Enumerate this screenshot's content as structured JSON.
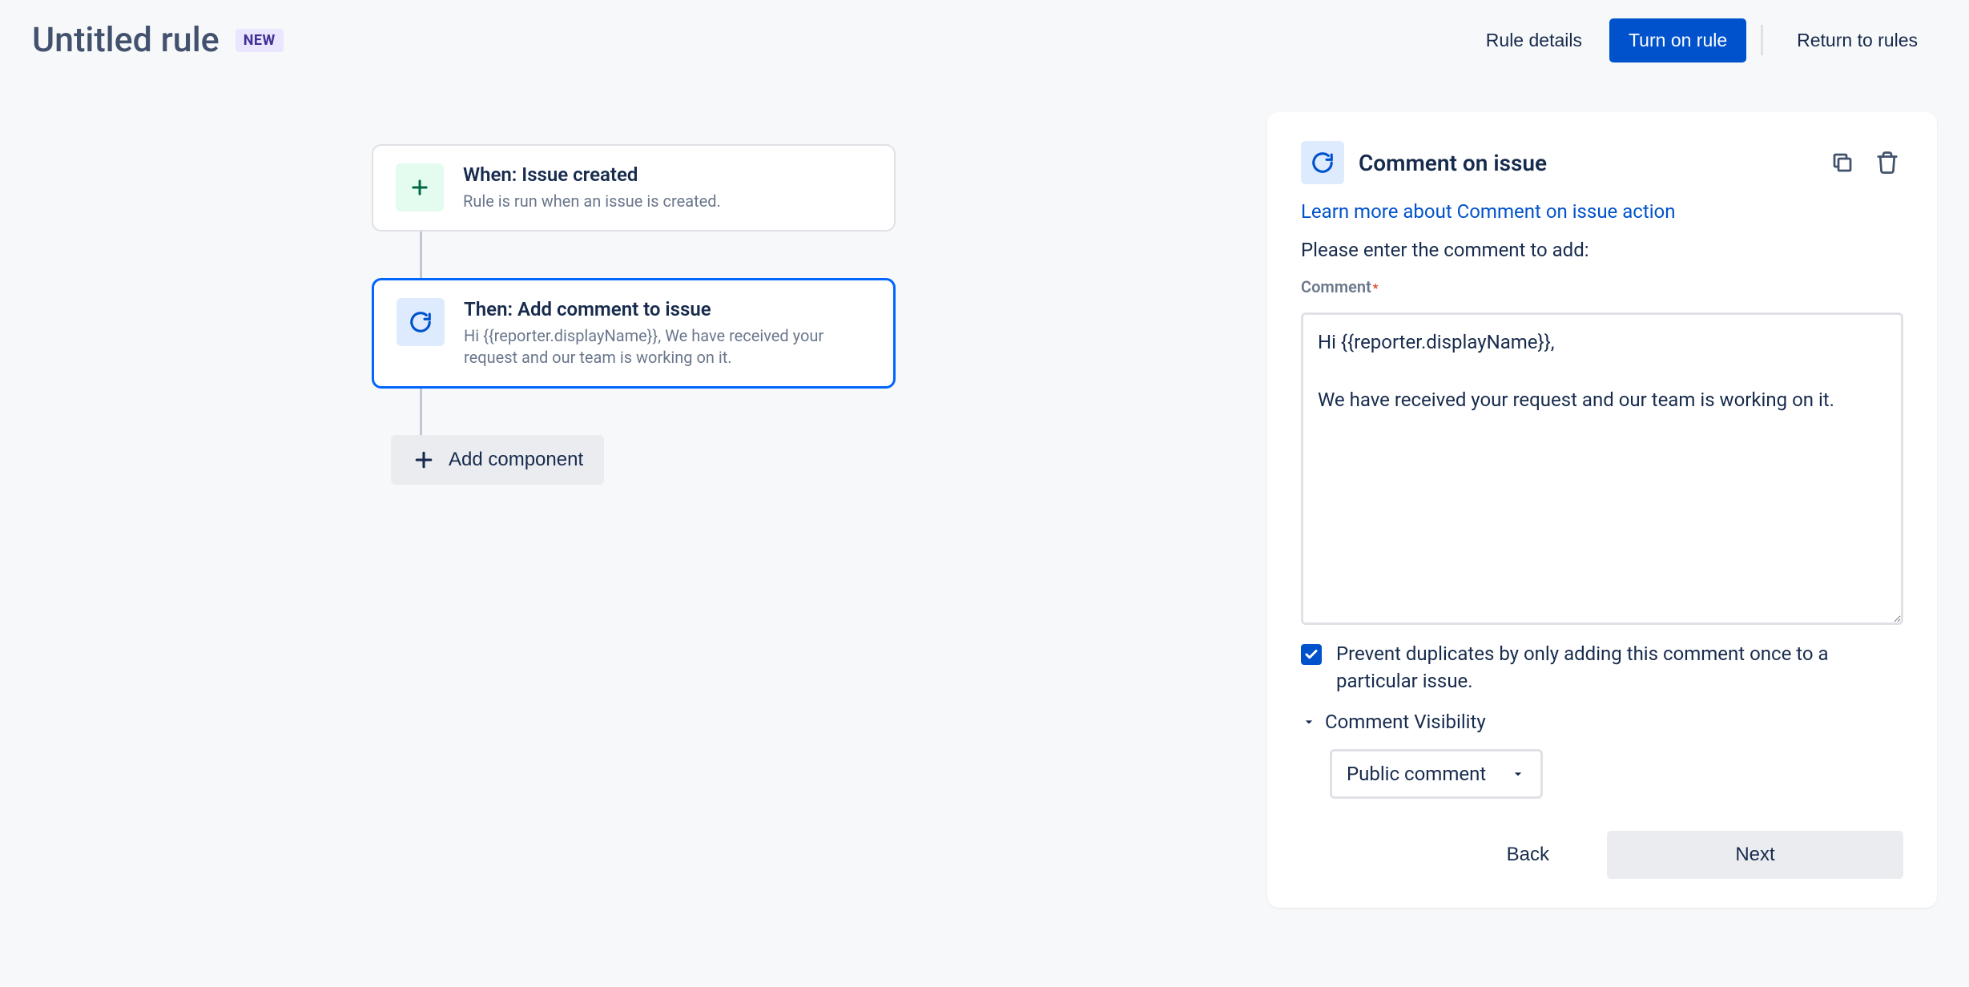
{
  "header": {
    "title": "Untitled rule",
    "badge": "NEW",
    "rule_details": "Rule details",
    "turn_on": "Turn on rule",
    "return": "Return to rules"
  },
  "flow": {
    "trigger": {
      "title": "When: Issue created",
      "desc": "Rule is run when an issue is created."
    },
    "action": {
      "title": "Then: Add comment to issue",
      "desc": "Hi {{reporter.displayName}}, We have received your request and our team is working on it."
    },
    "add_component": "Add component"
  },
  "panel": {
    "title": "Comment on issue",
    "learn_more": "Learn more about Comment on issue action",
    "instruction": "Please enter the comment to add:",
    "field_label": "Comment",
    "comment_value": "Hi {{reporter.displayName}},\n\nWe have received your request and our team is working on it.",
    "prevent_duplicates": "Prevent duplicates by only adding this comment once to a particular issue.",
    "visibility_label": "Comment Visibility",
    "visibility_value": "Public comment",
    "back": "Back",
    "next": "Next"
  }
}
